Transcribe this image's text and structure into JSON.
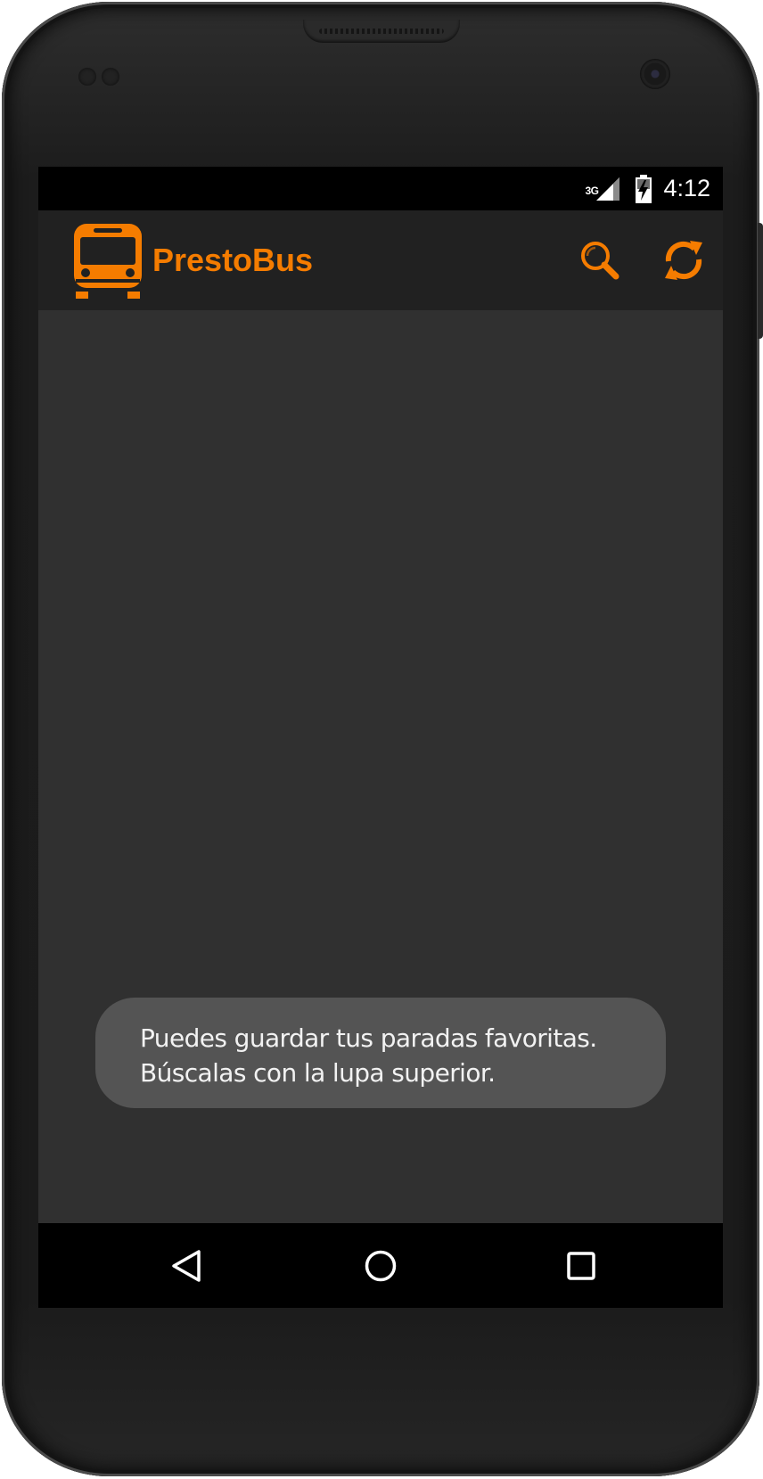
{
  "status_bar": {
    "network_type": "3G",
    "time": "4:12",
    "icons": [
      "signal-icon",
      "battery-charging-icon"
    ]
  },
  "app_bar": {
    "title": "PrestoBus",
    "logo_icon": "bus-icon",
    "actions": [
      {
        "icon": "search-icon"
      },
      {
        "icon": "refresh-icon"
      }
    ]
  },
  "toast": {
    "line1": "Puedes guardar tus paradas favoritas.",
    "line2": "Búscalas con la lupa superior."
  },
  "nav_bar": {
    "buttons": [
      {
        "icon": "back-icon"
      },
      {
        "icon": "home-icon"
      },
      {
        "icon": "recents-icon"
      }
    ]
  },
  "colors": {
    "accent": "#f57c00",
    "app_bar": "#212121",
    "background": "#303030",
    "toast": "#545454"
  }
}
